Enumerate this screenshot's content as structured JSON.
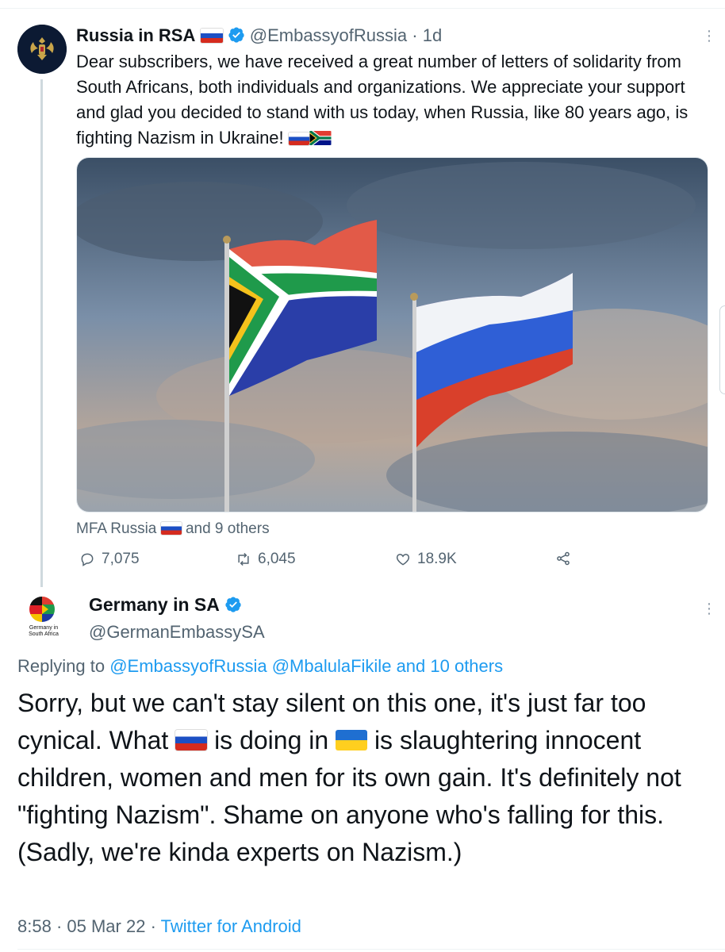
{
  "tweet1": {
    "name": "Russia in RSA",
    "handle": "@EmbassyofRussia",
    "separator": " · ",
    "time": "1d",
    "text": "Dear subscribers, we have received a great number of letters of solidarity from South Africans, both individuals and organizations. We appreciate your support and glad you decided to stand with us today, when Russia, like 80 years ago, is fighting Nazism in Ukraine!",
    "social_name": "MFA Russia",
    "social_rest": "and 9 others",
    "replies": "7,075",
    "retweets": "6,045",
    "likes": "18.9K"
  },
  "tweet2": {
    "name": "Germany in SA",
    "handle": "@GermanEmbassySA",
    "avatar_caption_1": "Germany in",
    "avatar_caption_2": "South Africa",
    "replying_prefix": "Replying to ",
    "replying_user1": "@EmbassyofRussia",
    "replying_user2": "@MbalulaFikile",
    "replying_others": "and 10 others",
    "text_part1": "Sorry, but we can't stay silent on this one, it's just far too cynical. What ",
    "text_part2": " is doing in ",
    "text_part3": " is slaughtering innocent children, women and men for its own gain. It's definitely not \"fighting Nazism\". Shame on anyone who's falling for this. (Sadly, we're kinda experts on Nazism.)",
    "time": "8:58",
    "date": "05 Mar 22",
    "source": "Twitter for Android",
    "meta_sep": " · "
  },
  "colors": {
    "link": "#1d9bf0",
    "secondary_text": "#536471",
    "verified": "#1d9bf0"
  },
  "icons": [
    "reply-icon",
    "retweet-icon",
    "like-icon",
    "share-icon",
    "verified-badge-icon",
    "more-options-icon"
  ]
}
